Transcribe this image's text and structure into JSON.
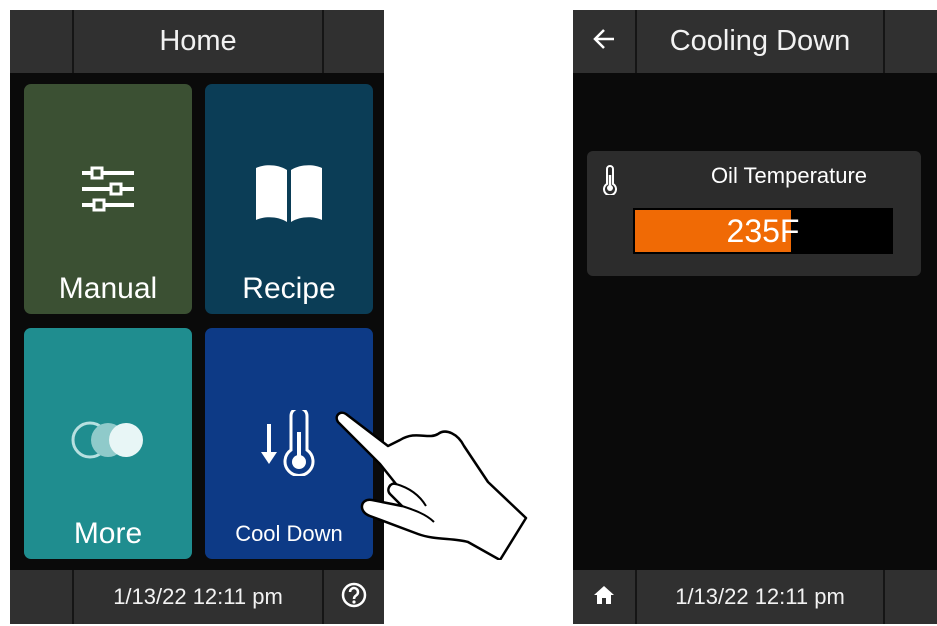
{
  "left_screen": {
    "header": {
      "title": "Home"
    },
    "tiles": [
      {
        "label": "Manual",
        "icon": "sliders-icon",
        "color": "#3b5033"
      },
      {
        "label": "Recipe",
        "icon": "book-icon",
        "color": "#0b3d56"
      },
      {
        "label": "More",
        "icon": "circles-icon",
        "color": "#1f8d8f"
      },
      {
        "label": "Cool Down",
        "icon": "thermometer-down-icon",
        "color": "#0d3a86"
      }
    ],
    "footer": {
      "datetime": "1/13/22 12:11 pm",
      "help_icon": "help-icon"
    }
  },
  "right_screen": {
    "header": {
      "title": "Cooling Down",
      "back_icon": "back-arrow-icon"
    },
    "card": {
      "label": "Oil Temperature",
      "icon": "thermometer-icon",
      "value": "235F",
      "fill_fraction": 0.6,
      "fill_color": "#f06a05"
    },
    "footer": {
      "datetime": "1/13/22 12:11 pm",
      "home_icon": "home-icon"
    }
  }
}
